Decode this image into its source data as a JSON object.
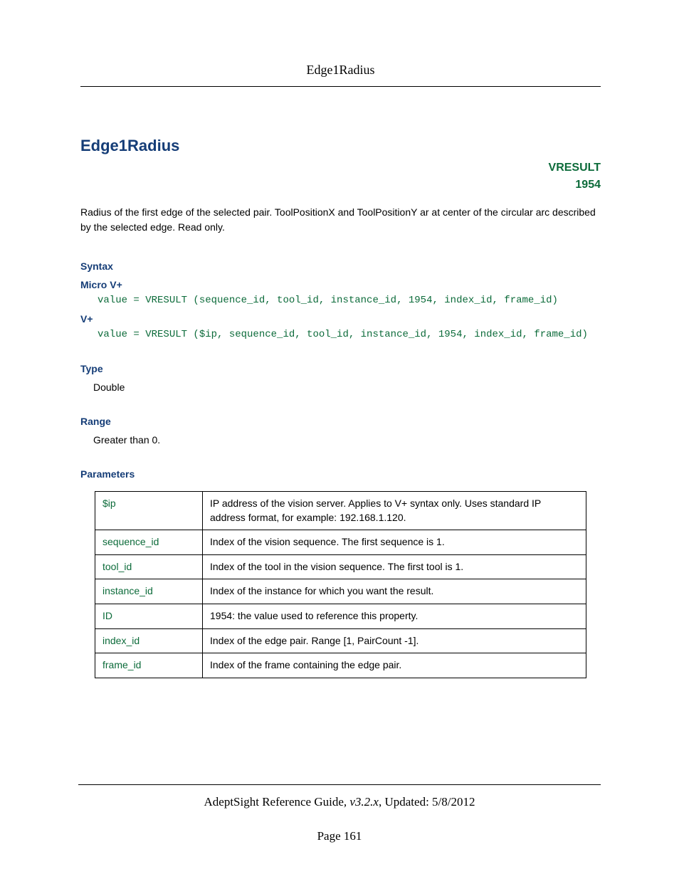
{
  "header": {
    "title": "Edge1Radius"
  },
  "topic": {
    "title": "Edge1Radius",
    "meta_kind": "VRESULT",
    "meta_id": "1954",
    "description": "Radius of the first edge of the selected pair. ToolPositionX and ToolPositionY ar at center of the circular arc described by the selected edge. Read only."
  },
  "syntax": {
    "heading": "Syntax",
    "micro_label": "Micro V+",
    "micro_code": "value = VRESULT (sequence_id, tool_id, instance_id, 1954, index_id, frame_id)",
    "vplus_label": "V+",
    "vplus_code": "value = VRESULT ($ip, sequence_id, tool_id, instance_id, 1954, index_id, frame_id)"
  },
  "type_section": {
    "heading": "Type",
    "value": "Double"
  },
  "range_section": {
    "heading": "Range",
    "value": "Greater than 0."
  },
  "params": {
    "heading": "Parameters",
    "rows": [
      {
        "name": "$ip",
        "desc": "IP address of the vision server. Applies to V+ syntax only. Uses standard IP address format, for example: 192.168.1.120."
      },
      {
        "name": "sequence_id",
        "desc": "Index of the vision sequence. The first sequence is 1."
      },
      {
        "name": "tool_id",
        "desc": "Index of the tool in the vision sequence. The first tool is 1."
      },
      {
        "name": "instance_id",
        "desc": "Index of the instance for which you want the result."
      },
      {
        "name": "ID",
        "desc": "1954: the value used to reference this property."
      },
      {
        "name": "index_id",
        "desc": "Index of the edge pair. Range [1, PairCount -1]."
      },
      {
        "name": "frame_id",
        "desc": "Index of the frame containing the edge pair."
      }
    ]
  },
  "footer": {
    "guide": "AdeptSight Reference Guide",
    "version": ", v3.2.x",
    "updated": ", Updated: 5/8/2012",
    "page": "Page 161"
  }
}
